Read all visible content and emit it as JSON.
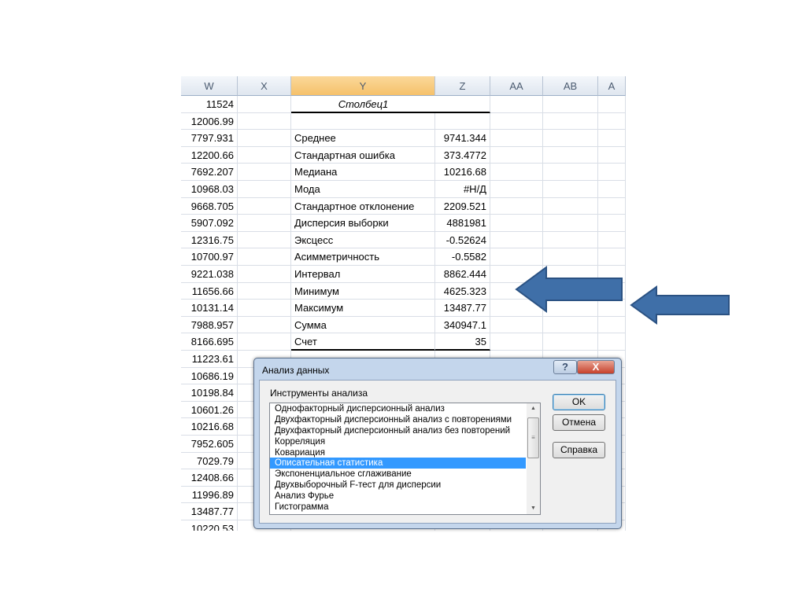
{
  "columns": [
    "W",
    "X",
    "Y",
    "Z",
    "AA",
    "AB",
    "A"
  ],
  "selected_column": "Y",
  "column_w_values": [
    "11524",
    "12006.99",
    "7797.931",
    "12200.66",
    "7692.207",
    "10968.03",
    "9668.705",
    "5907.092",
    "12316.75",
    "10700.97",
    "9221.038",
    "11656.66",
    "10131.14",
    "7988.957",
    "8166.695",
    "11223.61",
    "10686.19",
    "10198.84",
    "10601.26",
    "10216.68",
    "7952.605",
    "7029.79",
    "12408.66",
    "11996.89",
    "13487.77",
    "10220.53"
  ],
  "stats_header": "Столбец1",
  "stats": [
    {
      "label": "Среднее",
      "value": "9741.344"
    },
    {
      "label": "Стандартная ошибка",
      "value": "373.4772"
    },
    {
      "label": "Медиана",
      "value": "10216.68"
    },
    {
      "label": "Мода",
      "value": "#Н/Д"
    },
    {
      "label": "Стандартное отклонение",
      "value": "2209.521"
    },
    {
      "label": "Дисперсия выборки",
      "value": "4881981"
    },
    {
      "label": "Эксцесс",
      "value": "-0.52624"
    },
    {
      "label": "Асимметричность",
      "value": "-0.5582"
    },
    {
      "label": "Интервал",
      "value": "8862.444"
    },
    {
      "label": "Минимум",
      "value": "4625.323"
    },
    {
      "label": "Максимум",
      "value": "13487.77"
    },
    {
      "label": "Сумма",
      "value": "340947.1"
    },
    {
      "label": "Счет",
      "value": "35"
    }
  ],
  "dialog": {
    "title": "Анализ данных",
    "help_glyph": "?",
    "close_glyph": "X",
    "list_label": "Инструменты анализа",
    "tools": [
      "Однофакторный дисперсионный анализ",
      "Двухфакторный дисперсионный анализ с повторениями",
      "Двухфакторный дисперсионный анализ без повторений",
      "Корреляция",
      "Ковариация",
      "Описательная статистика",
      "Экспоненциальное сглаживание",
      "Двухвыборочный F-тест для дисперсии",
      "Анализ Фурье",
      "Гистограмма"
    ],
    "selected_tool": 5,
    "ok": "OK",
    "cancel": "Отмена",
    "help": "Справка"
  },
  "arrow_color": "#3f6fa8"
}
